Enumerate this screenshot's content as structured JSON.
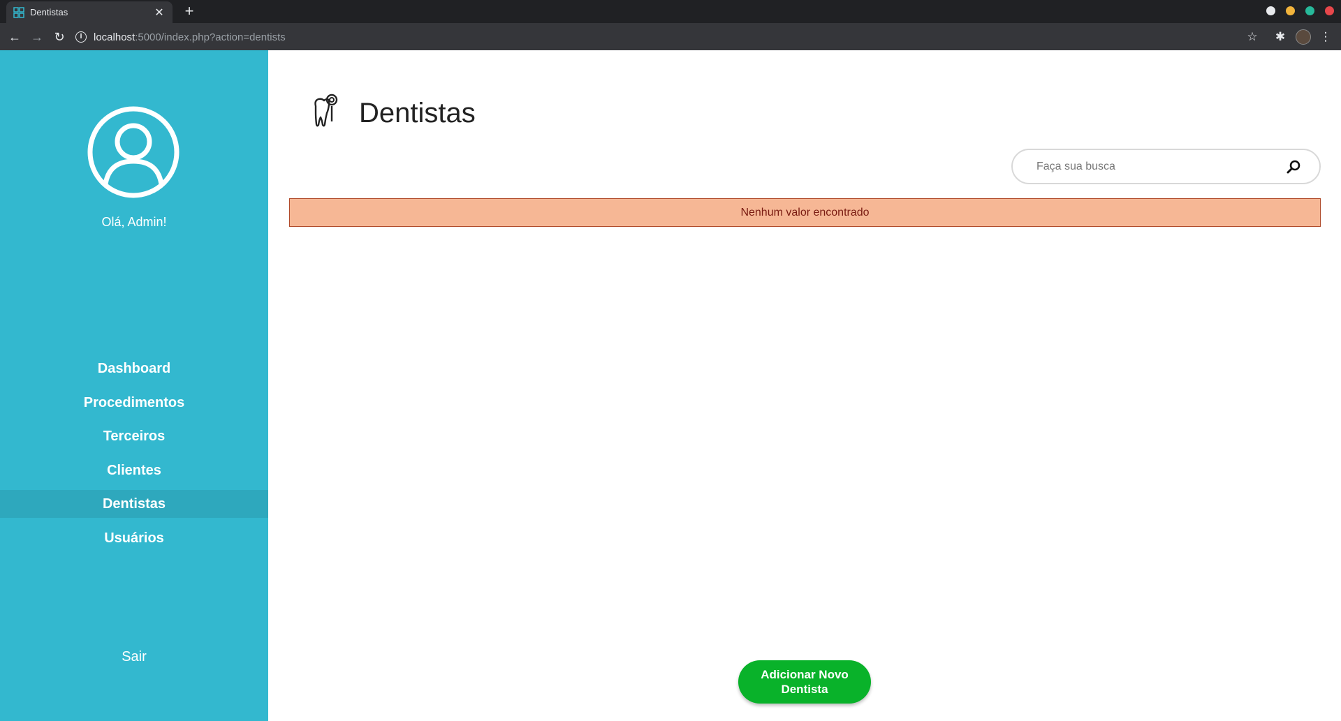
{
  "browser": {
    "tab_title": "Dentistas",
    "tab_close": "✕",
    "new_tab": "+",
    "url_host": "localhost",
    "url_rest": ":5000/index.php?action=dentists",
    "info_glyph": "i",
    "nav": {
      "back": "←",
      "forward": "→",
      "reload": "↻"
    },
    "right_icons": {
      "bookmark": "☆",
      "extensions": "✱",
      "menu": "⋮"
    },
    "window_colors": {
      "downloads": "#e8eaed",
      "minimize": "#f2b43c",
      "maximize": "#27b99a",
      "close": "#e7474b"
    }
  },
  "sidebar": {
    "greeting": "Olá, Admin!",
    "items": [
      {
        "label": "Dashboard",
        "active": false
      },
      {
        "label": "Procedimentos",
        "active": false
      },
      {
        "label": "Terceiros",
        "active": false
      },
      {
        "label": "Clientes",
        "active": false
      },
      {
        "label": "Dentistas",
        "active": true
      },
      {
        "label": "Usuários",
        "active": false
      }
    ],
    "logout": "Sair",
    "background": "#33b8cf"
  },
  "main": {
    "title": "Dentistas",
    "search_placeholder": "Faça sua busca",
    "alert": "Nenhum valor encontrado",
    "add_button": "Adicionar Novo Dentista",
    "add_button_color": "#09b22a"
  }
}
